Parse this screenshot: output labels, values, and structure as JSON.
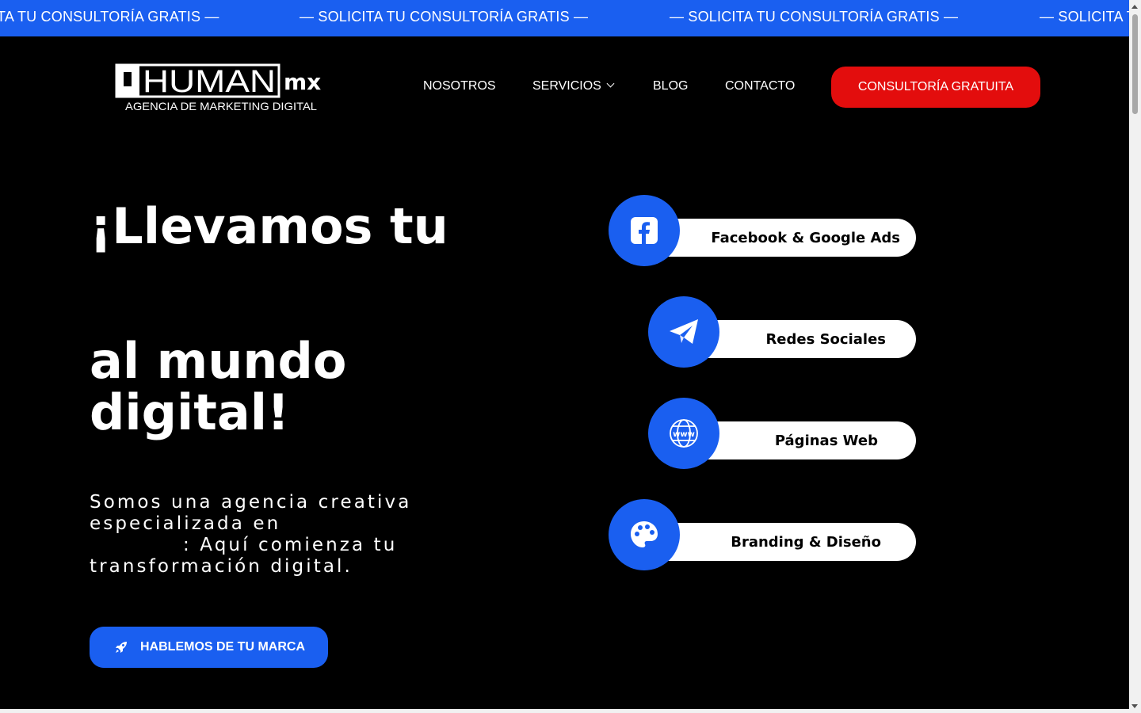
{
  "ticker": {
    "items": [
      "TA TU CONSULTORÍA GRATIS —",
      "— SOLICITA TU CONSULTORÍA GRATIS —",
      "— SOLICITA TU CONSULTORÍA GRATIS —",
      "— SOLICITA TU CONSULTORÍA GRATIS —"
    ]
  },
  "logo": {
    "brand": "HUMAN",
    "suffix": "mx",
    "tagline": "AGENCIA DE MARKETING DIGITAL"
  },
  "nav": {
    "items": [
      "NOSOTROS",
      "SERVICIOS",
      "BLOG",
      "CONTACTO"
    ],
    "cta": "CONSULTORÍA GRATUITA"
  },
  "hero": {
    "line1": "¡Llevamos tu",
    "line2": "al mundo",
    "line3": "digital!",
    "desc_part1": "Somos una agencia creativa especializada en",
    "desc_part2": ": Aquí comienza tu transformación digital.",
    "button": "HABLEMOS DE TU MARCA"
  },
  "services": [
    {
      "label": "Facebook & Google Ads",
      "icon": "facebook-icon"
    },
    {
      "label": "Redes Sociales",
      "icon": "paper-plane-icon"
    },
    {
      "label": "Páginas Web",
      "icon": "globe-www-icon"
    },
    {
      "label": "Branding & Diseño",
      "icon": "palette-icon"
    }
  ],
  "colors": {
    "accent_blue": "#1a5ff0",
    "cta_red": "#e30d0d",
    "background": "#000000"
  }
}
